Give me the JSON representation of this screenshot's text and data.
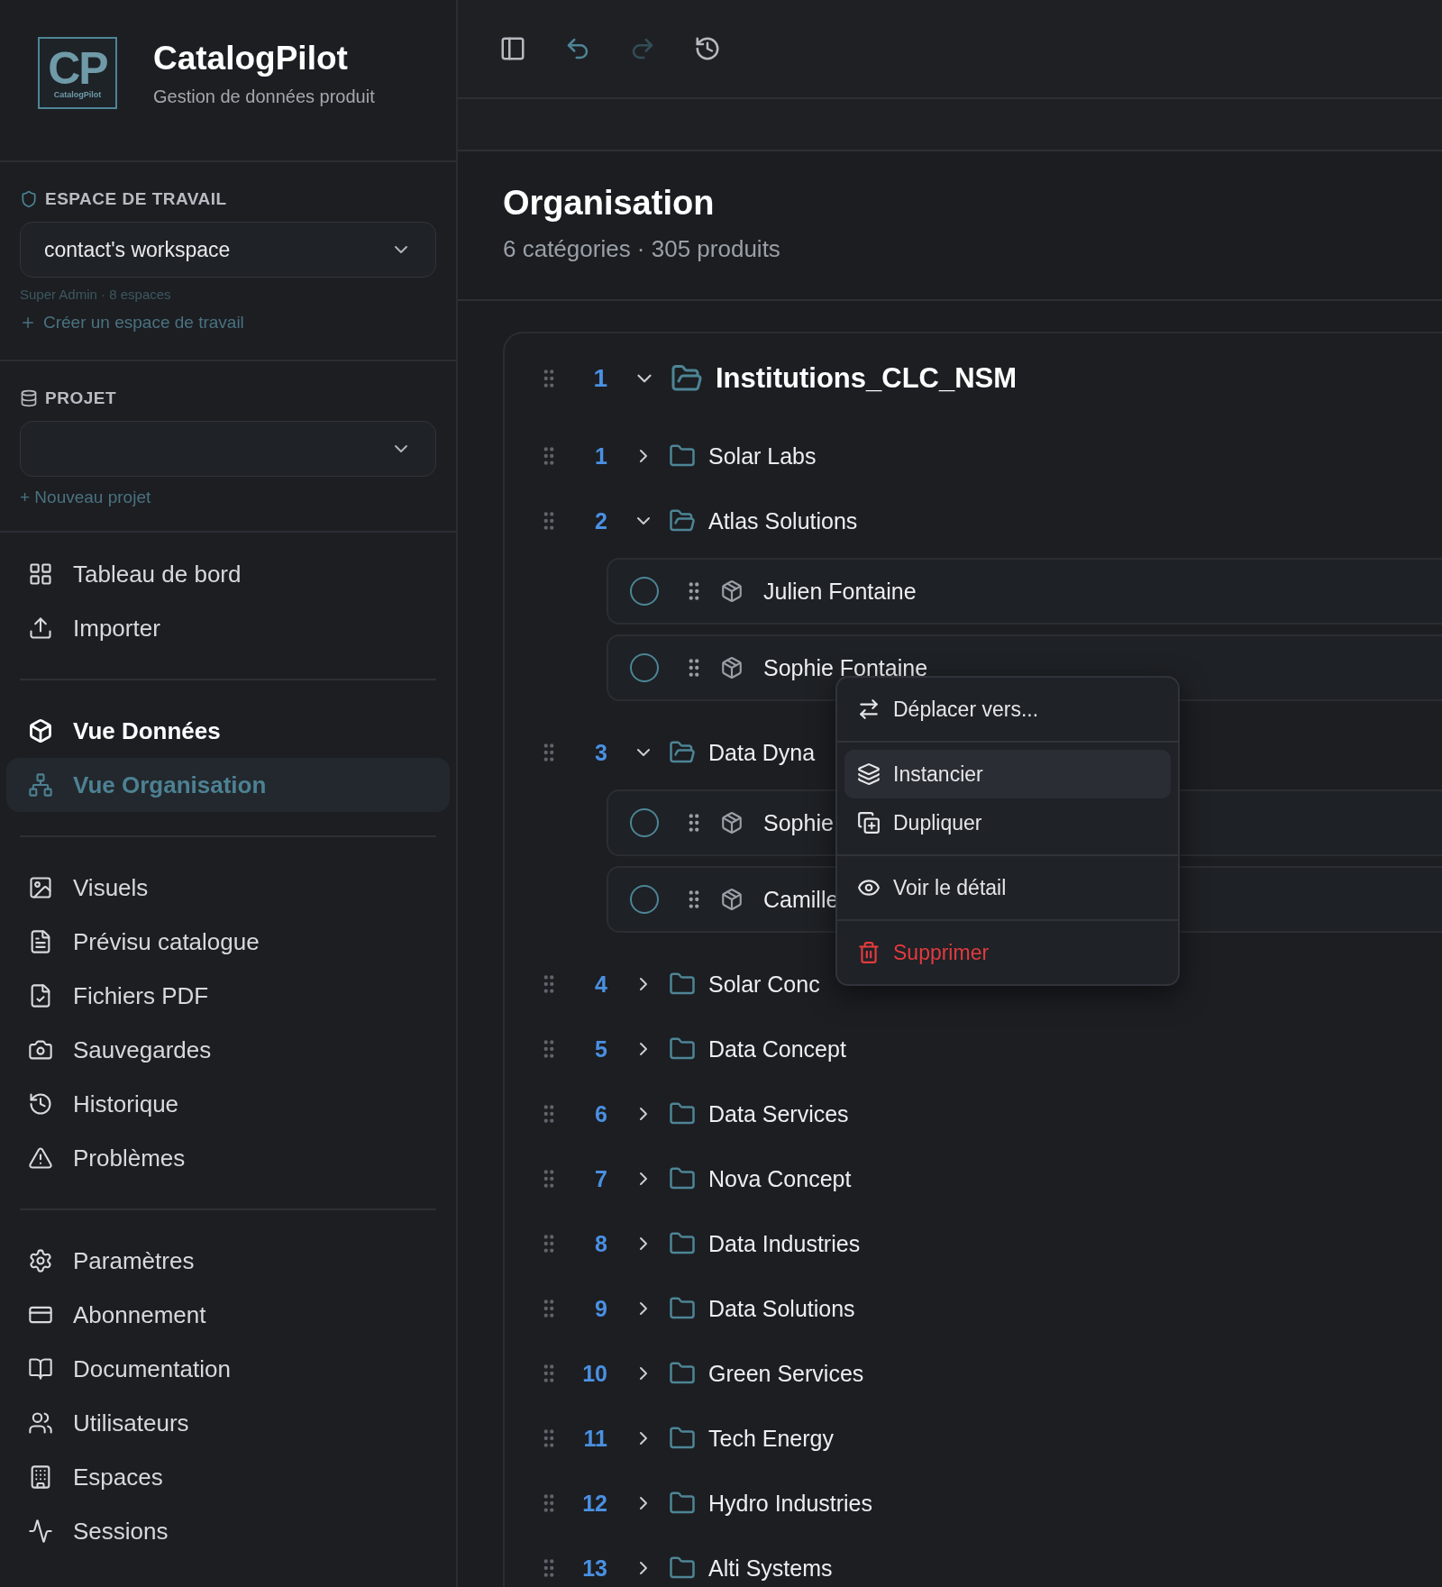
{
  "brand": {
    "logo_letters": "CP",
    "logo_caption": "CatalogPilot",
    "name": "CatalogPilot",
    "tagline": "Gestion de données produit"
  },
  "workspace": {
    "label": "ESPACE DE TRAVAIL",
    "value": "contact's workspace",
    "info": "Super Admin · 8 espaces",
    "create_link": "Créer un espace de travail"
  },
  "project": {
    "label": "PROJET",
    "new_link": "+ Nouveau projet"
  },
  "nav_groups": [
    {
      "items": [
        {
          "label": "Tableau de bord",
          "kind": "link",
          "selected": false
        },
        {
          "label": "Importer",
          "kind": "link",
          "selected": false
        }
      ]
    },
    {
      "items": [
        {
          "label": "Vue Données",
          "kind": "section",
          "selected": false
        },
        {
          "label": "Vue Organisation",
          "kind": "link",
          "selected": true
        }
      ]
    },
    {
      "items": [
        {
          "label": "Visuels",
          "kind": "link",
          "selected": false
        },
        {
          "label": "Prévisu catalogue",
          "kind": "link",
          "selected": false
        },
        {
          "label": "Fichiers PDF",
          "kind": "link",
          "selected": false
        },
        {
          "label": "Sauvegardes",
          "kind": "link",
          "selected": false
        },
        {
          "label": "Historique",
          "kind": "link",
          "selected": false
        },
        {
          "label": "Problèmes",
          "kind": "link",
          "selected": false
        }
      ]
    },
    {
      "items": [
        {
          "label": "Paramètres",
          "kind": "link",
          "selected": false
        },
        {
          "label": "Abonnement",
          "kind": "link",
          "selected": false
        },
        {
          "label": "Documentation",
          "kind": "link",
          "selected": false
        },
        {
          "label": "Utilisateurs",
          "kind": "link",
          "selected": false
        },
        {
          "label": "Espaces",
          "kind": "link",
          "selected": false
        },
        {
          "label": "Sessions",
          "kind": "link",
          "selected": false
        }
      ]
    }
  ],
  "toolbar": [
    {
      "kind": "sidebar",
      "disabled": false
    },
    {
      "kind": "undo",
      "disabled": false
    },
    {
      "kind": "redo",
      "disabled": true
    },
    {
      "kind": "history",
      "disabled": false
    }
  ],
  "page": {
    "title": "Organisation",
    "subtitle": "6 catégories · 305 produits"
  },
  "tree": {
    "number": "1",
    "label": "Institutions_CLC_NSM",
    "expanded": true,
    "children": [
      {
        "kind": "category",
        "number": "1",
        "label": "Solar Labs",
        "expanded": false
      },
      {
        "kind": "category",
        "number": "2",
        "label": "Atlas Solutions",
        "expanded": true,
        "children": [
          {
            "kind": "product",
            "label": "Julien Fontaine",
            "checked": false
          },
          {
            "kind": "product",
            "label": "Sophie Fontaine",
            "checked": false
          }
        ]
      },
      {
        "kind": "category",
        "number": "3",
        "label": "Data Dyna",
        "expanded": true,
        "children": [
          {
            "kind": "product",
            "label": "Sophie",
            "checked": false
          },
          {
            "kind": "product",
            "label": "Camille",
            "checked": false
          }
        ]
      },
      {
        "kind": "category",
        "number": "4",
        "label": "Solar Conc",
        "expanded": false
      },
      {
        "kind": "category",
        "number": "5",
        "label": "Data Concept",
        "expanded": false
      },
      {
        "kind": "category",
        "number": "6",
        "label": "Data Services",
        "expanded": false
      },
      {
        "kind": "category",
        "number": "7",
        "label": "Nova Concept",
        "expanded": false
      },
      {
        "kind": "category",
        "number": "8",
        "label": "Data Industries",
        "expanded": false
      },
      {
        "kind": "category",
        "number": "9",
        "label": "Data Solutions",
        "expanded": false
      },
      {
        "kind": "category",
        "number": "10",
        "label": "Green Services",
        "expanded": false
      },
      {
        "kind": "category",
        "number": "11",
        "label": "Tech Energy",
        "expanded": false
      },
      {
        "kind": "category",
        "number": "12",
        "label": "Hydro Industries",
        "expanded": false
      },
      {
        "kind": "category",
        "number": "13",
        "label": "Alti Systems",
        "expanded": false
      }
    ]
  },
  "context_menu": {
    "groups": [
      {
        "items": [
          {
            "label": "Déplacer vers...",
            "kind": "normal",
            "selected": false
          }
        ]
      },
      {
        "items": [
          {
            "label": "Instancier",
            "kind": "normal",
            "selected": true
          },
          {
            "label": "Dupliquer",
            "kind": "normal",
            "selected": false
          }
        ]
      },
      {
        "items": [
          {
            "label": "Voir le détail",
            "kind": "normal",
            "selected": false
          }
        ]
      },
      {
        "items": [
          {
            "label": "Supprimer",
            "kind": "danger",
            "selected": false
          }
        ]
      }
    ]
  }
}
